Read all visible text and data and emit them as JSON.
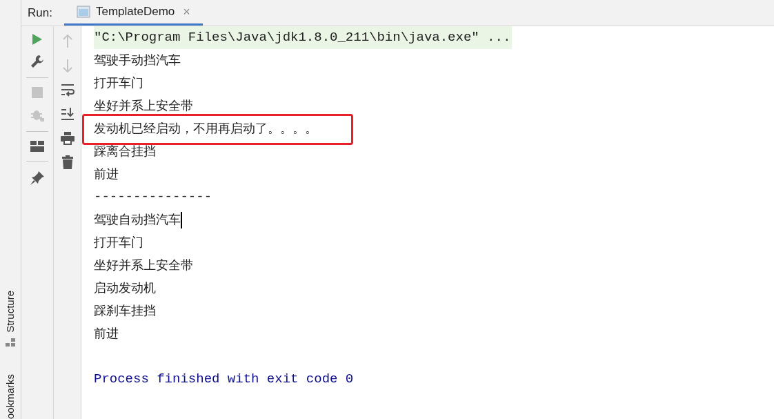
{
  "run_panel": {
    "label": "Run:",
    "tabs": [
      {
        "title": "TemplateDemo",
        "selected": true,
        "close": "×"
      }
    ]
  },
  "side_stripe": [
    "Structure",
    "ookmarks"
  ],
  "console": {
    "lines": [
      {
        "kind": "command",
        "text": "\"C:\\Program Files\\Java\\jdk1.8.0_211\\bin\\java.exe\" ..."
      },
      {
        "kind": "output",
        "text": "驾驶手动挡汽车"
      },
      {
        "kind": "output",
        "text": "打开车门"
      },
      {
        "kind": "output",
        "text": "坐好并系上安全带"
      },
      {
        "kind": "output",
        "text": "发动机已经启动，不用再启动了。。。。",
        "highlighted": true
      },
      {
        "kind": "output",
        "text": "踩离合挂挡"
      },
      {
        "kind": "output",
        "text": "前进"
      },
      {
        "kind": "separator",
        "text": "---------------"
      },
      {
        "kind": "output",
        "text": "驾驶自动挡汽车",
        "caret": true
      },
      {
        "kind": "output",
        "text": "打开车门"
      },
      {
        "kind": "output",
        "text": "坐好并系上安全带"
      },
      {
        "kind": "output",
        "text": "启动发动机"
      },
      {
        "kind": "output",
        "text": "踩刹车挂挡"
      },
      {
        "kind": "output",
        "text": "前进"
      },
      {
        "kind": "exit",
        "text": "Process finished with exit code 0"
      }
    ]
  }
}
